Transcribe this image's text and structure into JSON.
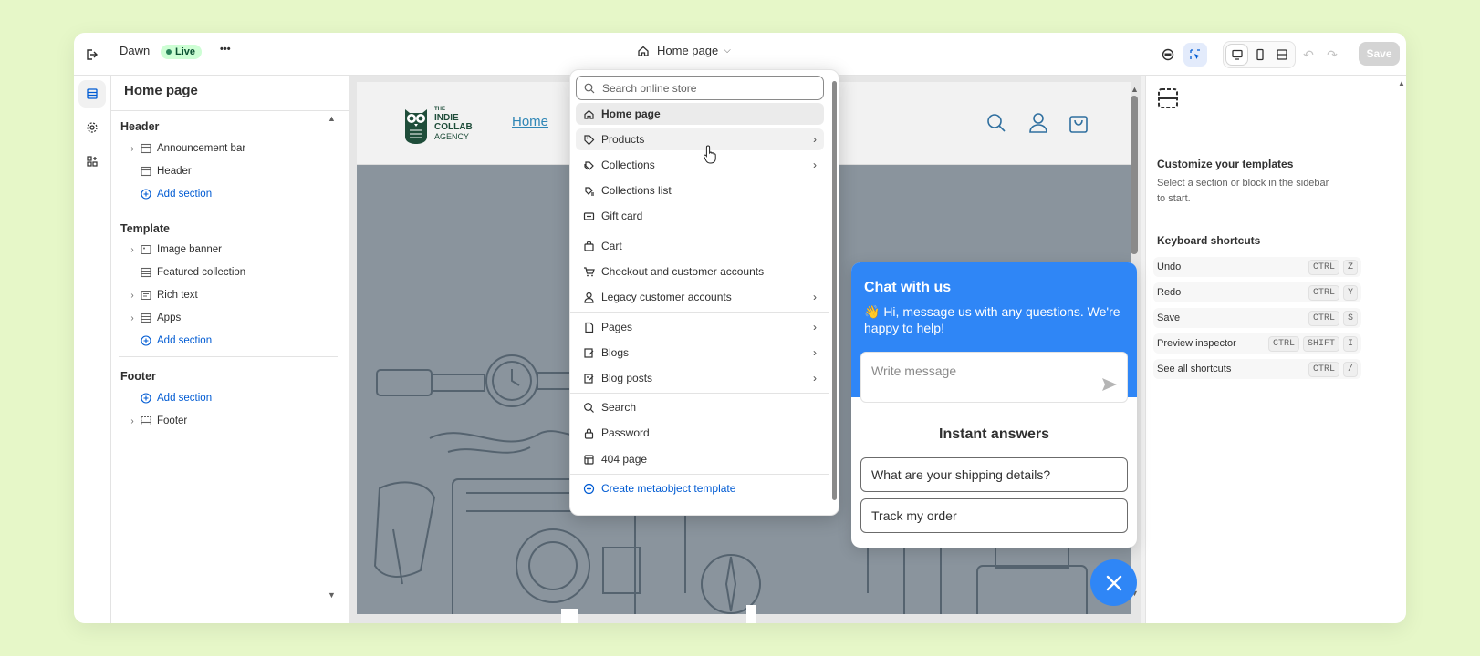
{
  "topbar": {
    "theme_name": "Dawn",
    "status": "Live",
    "more": "•••",
    "page_selector": "Home page",
    "save_label": "Save"
  },
  "sidebar": {
    "title": "Home page",
    "header_group": "Header",
    "header_items": [
      "Announcement bar",
      "Header"
    ],
    "template_group": "Template",
    "template_items": [
      "Image banner",
      "Featured collection",
      "Rich text",
      "Apps"
    ],
    "footer_group": "Footer",
    "footer_items": [
      "Footer"
    ],
    "add_section": "Add section"
  },
  "store": {
    "logo_line1": "THE",
    "logo_line2": "INDIE",
    "logo_line3": "COLLAB",
    "logo_line4": "AGENCY",
    "nav_home": "Home"
  },
  "dropdown": {
    "search_placeholder": "Search online store",
    "items": [
      {
        "label": "Home page",
        "icon": "home-icon"
      },
      {
        "label": "Products",
        "icon": "tag-icon"
      },
      {
        "label": "Collections",
        "icon": "collection-icon"
      },
      {
        "label": "Collections list",
        "icon": "collection-list-icon"
      },
      {
        "label": "Gift card",
        "icon": "gift-card-icon"
      },
      {
        "label": "Cart",
        "icon": "cart-icon"
      },
      {
        "label": "Checkout and customer accounts",
        "icon": "checkout-icon"
      },
      {
        "label": "Legacy customer accounts",
        "icon": "person-icon"
      },
      {
        "label": "Pages",
        "icon": "page-icon"
      },
      {
        "label": "Blogs",
        "icon": "blog-icon"
      },
      {
        "label": "Blog posts",
        "icon": "blog-post-icon"
      },
      {
        "label": "Search",
        "icon": "search-icon"
      },
      {
        "label": "Password",
        "icon": "lock-icon"
      },
      {
        "label": "404 page",
        "icon": "404-icon"
      }
    ],
    "create_label": "Create metaobject template"
  },
  "chat": {
    "title": "Chat with us",
    "subtitle": "👋 Hi, message us with any questions. We're happy to help!",
    "placeholder": "Write message",
    "instant": "Instant answers",
    "q1": "What are your shipping details?",
    "q2": "Track my order"
  },
  "right_panel": {
    "title": "Customize your templates",
    "desc": "Select a section or block in the sidebar to start.",
    "shortcuts_title": "Keyboard shortcuts",
    "shortcuts": [
      {
        "label": "Undo",
        "keys": [
          "CTRL",
          "Z"
        ]
      },
      {
        "label": "Redo",
        "keys": [
          "CTRL",
          "Y"
        ]
      },
      {
        "label": "Save",
        "keys": [
          "CTRL",
          "S"
        ]
      },
      {
        "label": "Preview inspector",
        "keys": [
          "CTRL",
          "SHIFT",
          "I"
        ]
      },
      {
        "label": "See all shortcuts",
        "keys": [
          "CTRL",
          "/"
        ]
      }
    ]
  },
  "colors": {
    "accent": "#005bd3",
    "chat": "#2f86f6",
    "live_badge": "#cdfed4"
  }
}
